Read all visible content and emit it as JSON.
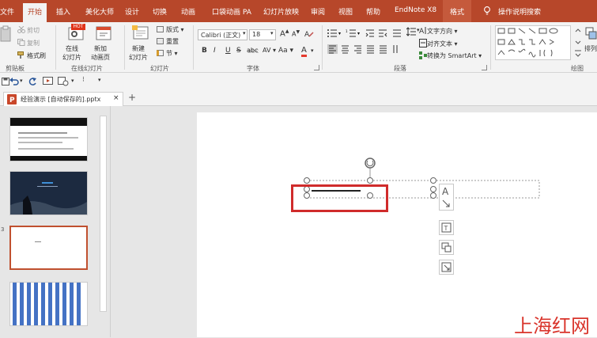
{
  "ribbon_tabs": [
    "文件",
    "开始",
    "插入",
    "美化大师",
    "设计",
    "切换",
    "动画",
    "口袋动画 PA",
    "幻灯片放映",
    "审阅",
    "视图",
    "帮助",
    "EndNote X8",
    "格式"
  ],
  "tell_me": "操作说明搜索",
  "clipboard": {
    "cut": "剪切",
    "copy": "复制",
    "format_painter": "格式刷",
    "label": "剪贴板"
  },
  "online_slides": {
    "online_btn": "在线\n幻灯片",
    "new_page_btn": "新加\n动画页",
    "badge": "HOT",
    "label": "在线幻灯片"
  },
  "slides": {
    "new_slide": "新建\n幻灯片",
    "layout": "版式",
    "reset": "重置",
    "section": "节",
    "label": "幻灯片"
  },
  "font": {
    "name": "Calibri (正文)",
    "size": "18",
    "label": "字体",
    "bold": "B",
    "italic": "I",
    "underline": "U",
    "strike": "S",
    "shadow": "abc",
    "spacing": "AV",
    "case": "Aa",
    "color": "A"
  },
  "paragraph": {
    "text_direction": "文字方向",
    "align_text": "对齐文本",
    "smartart": "转换为 SmartArt",
    "label": "段落"
  },
  "drawing": {
    "arrange": "排列",
    "label": "绘图"
  },
  "doc_tab": "经验演示 [自动保存的].pptx",
  "thumb_numbers": [
    "3"
  ],
  "watermark": "上海红网"
}
